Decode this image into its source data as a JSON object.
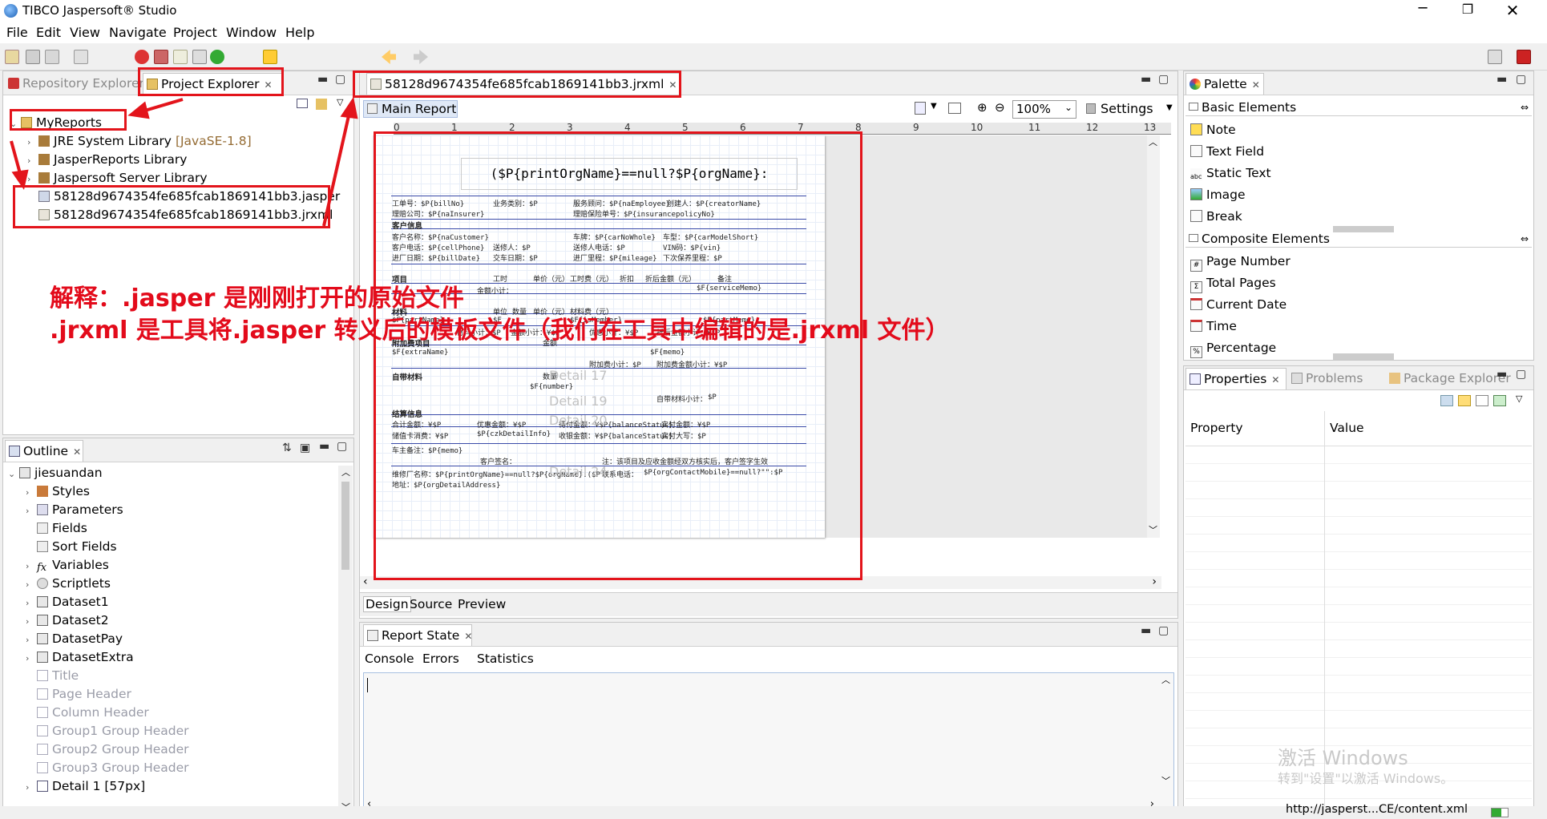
{
  "window": {
    "title": "TIBCO Jaspersoft® Studio"
  },
  "menu": [
    "File",
    "Edit",
    "View",
    "Navigate",
    "Project",
    "Window",
    "Help"
  ],
  "left_top": {
    "tabs": [
      {
        "label": "Repository Explorer"
      },
      {
        "label": "Project Explorer"
      }
    ],
    "tree": [
      {
        "label": "MyReports"
      },
      {
        "label": "JRE System Library",
        "suffix": "[JavaSE-1.8]"
      },
      {
        "label": "JasperReports Library"
      },
      {
        "label": "Jaspersoft Server Library"
      },
      {
        "label": "58128d9674354fe685fcab1869141bb3.jasper"
      },
      {
        "label": "58128d9674354fe685fcab1869141bb3.jrxml"
      }
    ]
  },
  "outline": {
    "tab": "Outline",
    "items": [
      {
        "label": "jiesuandan"
      },
      {
        "label": "Styles"
      },
      {
        "label": "Parameters"
      },
      {
        "label": "Fields"
      },
      {
        "label": "Sort Fields"
      },
      {
        "label": "Variables"
      },
      {
        "label": "Scriptlets"
      },
      {
        "label": "Dataset1"
      },
      {
        "label": "Dataset2"
      },
      {
        "label": "DatasetPay"
      },
      {
        "label": "DatasetExtra"
      },
      {
        "label": "Title"
      },
      {
        "label": "Page Header"
      },
      {
        "label": "Column Header"
      },
      {
        "label": "Group1 Group Header"
      },
      {
        "label": "Group2 Group Header"
      },
      {
        "label": "Group3 Group Header"
      },
      {
        "label": "Detail 1 [57px]"
      }
    ]
  },
  "editor": {
    "tab": "58128d9674354fe685fcab1869141bb3.jrxml",
    "sub_tab": "Main Report",
    "zoom": "100%",
    "settings": "Settings",
    "ruler": [
      "0",
      "1",
      "2",
      "3",
      "4",
      "5",
      "6",
      "7",
      "8",
      "9",
      "10",
      "11",
      "12",
      "13"
    ],
    "bottom_tabs": [
      "Design",
      "Source",
      "Preview"
    ],
    "report": {
      "title": "($P{printOrgName}==null?$P{orgName}:",
      "lines": [
        "工单号：$P{billNo}",
        "业务类别：$P",
        "服务顾问：$P{naEmployee}",
        "创建人：$P{creatorName}",
        "理赔公司：$P{naInsurer}",
        "理赔保险单号：$P{insurancepolicyNo}",
        "客户信息",
        "客户名称：$P{naCustomer}",
        "车牌：$P{carNoWhole}",
        "车型：$P{carModelShort}",
        "客户电话：$P{cellPhone}",
        "送修人：$P",
        "送修人电话：$P",
        "VIN码：$P{vin}",
        "进厂日期：$P{billDate}",
        "交车日期：$P",
        "进厂里程：$P{mileage}",
        "下次保养里程：$P",
        "项目",
        "工时",
        "单价（元）",
        "工时费（元）",
        "折扣",
        "折后金额（元）",
        "备注",
        "$F{serviceMemo}",
        "材料",
        "单位",
        "数量",
        "单价（元）",
        "材料费（元）",
        "$F{partName}",
        "$F",
        "$F{isMember}",
        "$F{partMemo}",
        "材料小计：$P",
        "金额小计：¥$P",
        "优惠小计：¥$P",
        "折后金额小计：¥$P",
        "附加费项目",
        "金额",
        "$F{extraName}",
        "$F{memo}",
        "附加费小计：$P",
        "附加费金额小计：¥$P",
        "自带材料",
        "数量",
        "$F{number}",
        "自带材料小计：",
        "$P",
        "结算信息",
        "合计金额：¥$P",
        "优惠金额：¥$P",
        "待付金额：¥$P{balanceStatus}",
        "实付金额：¥$P",
        "储值卡消费：¥$P",
        "$P{czkDetailInfo}",
        "收银金额：¥$P{balanceStatus}",
        "实付大写：$P",
        "车主备注：$P{memo}",
        "客户签名：",
        "注：该项目及应收金额经双方核实后，客户签字生效",
        "维修厂名称：$P{printOrgName}==null?$P{orgName}:($P",
        "联系电话：",
        "$P{orgContactMobile}==null?\"\":$P",
        "地址：$P{orgDetailAddress}",
        "金额小计：",
        "Detail 17",
        "Detail 19",
        "Detail 20",
        "Detail 24"
      ]
    }
  },
  "report_state": {
    "tab": "Report State",
    "subtabs": [
      "Console",
      "Errors",
      "Statistics"
    ]
  },
  "palette": {
    "tab": "Palette",
    "basic_header": "Basic Elements",
    "basic": [
      "Note",
      "Text Field",
      "Static Text",
      "Image",
      "Break"
    ],
    "composite_header": "Composite Elements",
    "composite": [
      "Page Number",
      "Total Pages",
      "Current Date",
      "Time",
      "Percentage"
    ]
  },
  "properties": {
    "tabs": [
      "Properties",
      "Problems",
      "Package Explorer"
    ],
    "columns": [
      "Property",
      "Value"
    ]
  },
  "annotation": {
    "line1": "解释：.jasper 是刚刚打开的原始文件",
    "line2": ".jrxml 是工具将.jasper 转义后的模板文件（我们在工具中编辑的是.jrxml 文件）"
  },
  "watermark": {
    "line1": "激活 Windows",
    "line2": "转到\"设置\"以激活 Windows。"
  },
  "status_bar": {
    "url": "http://jasperst...CE/content.xml"
  },
  "colors": {
    "annotation_red": "#e3141b",
    "accent_blue": "#1a5fb4"
  }
}
